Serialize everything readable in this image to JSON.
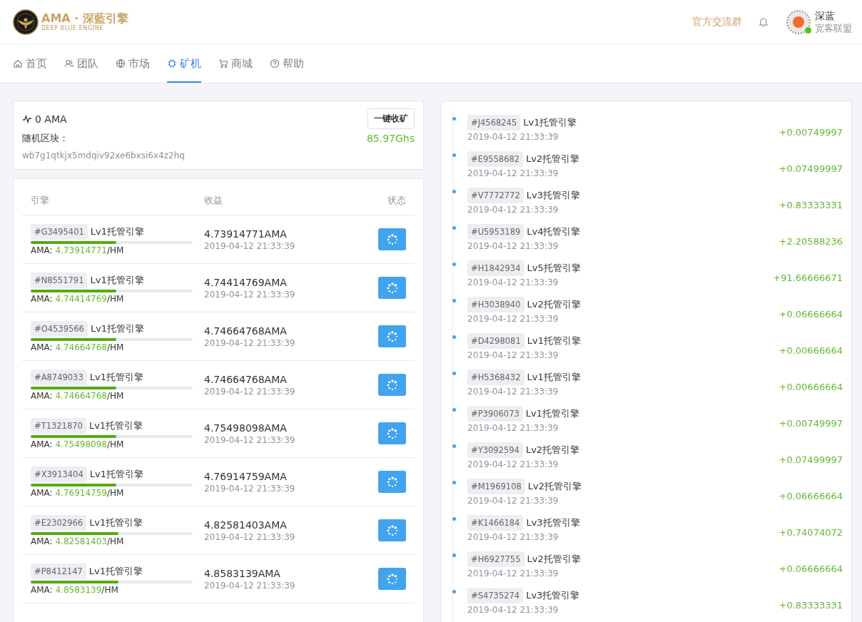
{
  "header": {
    "logo_title": "AMA · 深藍引擎",
    "logo_subtitle": "DEEP BLUE ENGINE",
    "group_link": "官方交流群",
    "user": {
      "name": "深蓝",
      "org": "宽客联盟",
      "online": true
    }
  },
  "nav": [
    {
      "label": "首页",
      "selected": false
    },
    {
      "label": "团队",
      "selected": false
    },
    {
      "label": "市场",
      "selected": false
    },
    {
      "label": "矿机",
      "selected": true
    },
    {
      "label": "商城",
      "selected": false
    },
    {
      "label": "帮助",
      "selected": false
    }
  ],
  "summary": {
    "balance": "0 AMA",
    "collect_button": "一键收矿",
    "block_label": "随机区块：",
    "hashrate": "85.97Ghs",
    "block_hash": "wb7g1qtkjx5mdqiv92xe6bxsi6x4z2hq"
  },
  "engines": {
    "columns": [
      "引擎",
      "收益",
      "状态"
    ],
    "rows": [
      {
        "tag": "#G3495401",
        "name": "Lv1托管引擎",
        "level": 0.53,
        "rate_label": "AMA:",
        "rate": "4.73914771",
        "rate_unit": "/HM",
        "income": "4.73914771AMA",
        "time": "2019-04-12 21:33:39"
      },
      {
        "tag": "#N8551791",
        "name": "Lv1托管引擎",
        "level": 0.53,
        "rate_label": "AMA:",
        "rate": "4.74414769",
        "rate_unit": "/HM",
        "income": "4.74414769AMA",
        "time": "2019-04-12 21:33:39"
      },
      {
        "tag": "#O4539566",
        "name": "Lv1托管引擎",
        "level": 0.53,
        "rate_label": "AMA:",
        "rate": "4.74664768",
        "rate_unit": "/HM",
        "income": "4.74664768AMA",
        "time": "2019-04-12 21:33:39"
      },
      {
        "tag": "#A8749033",
        "name": "Lv1托管引擎",
        "level": 0.53,
        "rate_label": "AMA:",
        "rate": "4.74664768",
        "rate_unit": "/HM",
        "income": "4.74664768AMA",
        "time": "2019-04-12 21:33:39"
      },
      {
        "tag": "#T1321870",
        "name": "Lv1托管引擎",
        "level": 0.53,
        "rate_label": "AMA:",
        "rate": "4.75498098",
        "rate_unit": "/HM",
        "income": "4.75498098AMA",
        "time": "2019-04-12 21:33:39"
      },
      {
        "tag": "#X3913404",
        "name": "Lv1托管引擎",
        "level": 0.53,
        "rate_label": "AMA:",
        "rate": "4.76914759",
        "rate_unit": "/HM",
        "income": "4.76914759AMA",
        "time": "2019-04-12 21:33:39"
      },
      {
        "tag": "#E2302966",
        "name": "Lv1托管引擎",
        "level": 0.54,
        "rate_label": "AMA:",
        "rate": "4.82581403",
        "rate_unit": "/HM",
        "income": "4.82581403AMA",
        "time": "2019-04-12 21:33:39"
      },
      {
        "tag": "#P8412147",
        "name": "Lv1托管引擎",
        "level": 0.54,
        "rate_label": "AMA:",
        "rate": "4.8583139",
        "rate_unit": "/HM",
        "income": "4.8583139AMA",
        "time": "2019-04-12 21:33:39"
      }
    ]
  },
  "timeline": [
    {
      "tag": "#J4568245",
      "name": "Lv1托管引擎",
      "time": "2019-04-12 21:33:39",
      "amount": "+0.00749997"
    },
    {
      "tag": "#E9558682",
      "name": "Lv2托管引擎",
      "time": "2019-04-12 21:33:39",
      "amount": "+0.07499997"
    },
    {
      "tag": "#V7772772",
      "name": "Lv3托管引擎",
      "time": "2019-04-12 21:33:39",
      "amount": "+0.83333331"
    },
    {
      "tag": "#U5953189",
      "name": "Lv4托管引擎",
      "time": "2019-04-12 21:33:39",
      "amount": "+2.20588236"
    },
    {
      "tag": "#H1842934",
      "name": "Lv5托管引擎",
      "time": "2019-04-12 21:33:39",
      "amount": "+91.66666671"
    },
    {
      "tag": "#H3038940",
      "name": "Lv2托管引擎",
      "time": "2019-04-12 21:33:39",
      "amount": "+0.06666664"
    },
    {
      "tag": "#D4298081",
      "name": "Lv1托管引擎",
      "time": "2019-04-12 21:33:39",
      "amount": "+0.00666664"
    },
    {
      "tag": "#H5368432",
      "name": "Lv1托管引擎",
      "time": "2019-04-12 21:33:39",
      "amount": "+0.00666664"
    },
    {
      "tag": "#P3906073",
      "name": "Lv1托管引擎",
      "time": "2019-04-12 21:33:39",
      "amount": "+0.00749997"
    },
    {
      "tag": "#Y3092594",
      "name": "Lv2托管引擎",
      "time": "2019-04-12 21:33:39",
      "amount": "+0.07499997"
    },
    {
      "tag": "#M1969108",
      "name": "Lv2托管引擎",
      "time": "2019-04-12 21:33:39",
      "amount": "+0.06666664"
    },
    {
      "tag": "#K1466184",
      "name": "Lv3托管引擎",
      "time": "2019-04-12 21:33:39",
      "amount": "+0.74074072"
    },
    {
      "tag": "#H6927755",
      "name": "Lv2托管引擎",
      "time": "2019-04-12 21:33:39",
      "amount": "+0.06666664"
    },
    {
      "tag": "#S4735274",
      "name": "Lv3托管引擎",
      "time": "2019-04-12 21:33:39",
      "amount": "+0.83333331"
    }
  ]
}
